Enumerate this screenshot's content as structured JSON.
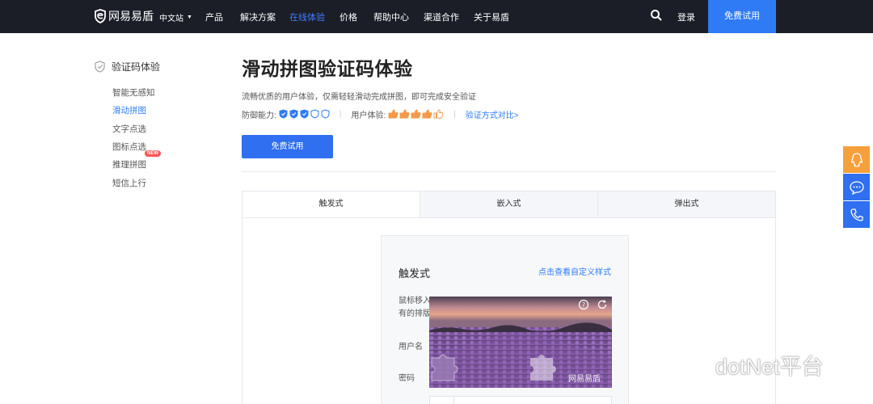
{
  "nav": {
    "brand": "网易易盾",
    "lang": "中文站",
    "items": [
      "产品",
      "解决方案",
      "在线体验",
      "价格",
      "帮助中心",
      "渠道合作",
      "关于易盾"
    ],
    "active_index": 2,
    "login": "登录",
    "trial": "免费试用"
  },
  "sidebar": {
    "heading": "验证码体验",
    "items": [
      "智能无感知",
      "滑动拼图",
      "文字点选",
      "图标点选",
      "推理拼图",
      "短信上行"
    ],
    "active_index": 1,
    "new_badge": "NEW"
  },
  "main": {
    "title": "滑动拼图验证码体验",
    "description": "流畅优质的用户体验，仅需轻轻滑动完成拼图，即可完成安全验证",
    "defense_label": "防御能力:",
    "defense_level": 3,
    "defense_max": 5,
    "ux_label": "用户体验:",
    "ux_level": 4,
    "ux_max": 5,
    "compare_link": "验证方式对比>",
    "cta": "免费试用"
  },
  "tabs": [
    "触发式",
    "嵌入式",
    "弹出式"
  ],
  "active_tab": 0,
  "demo": {
    "title": "触发式",
    "custom_link": "点击查看自定义样式",
    "hint_line1": "鼠标移入",
    "hint_line2": "有的排版",
    "username_label": "用户名",
    "password_label": "密码",
    "watermark": "网易易盾"
  },
  "watermark": "dotNet平台",
  "colors": {
    "brand_blue": "#2f7bf6",
    "nav_bg": "#1b1e27",
    "qq_orange": "#f5a03a",
    "thumb_orange": "#f39a4a"
  }
}
